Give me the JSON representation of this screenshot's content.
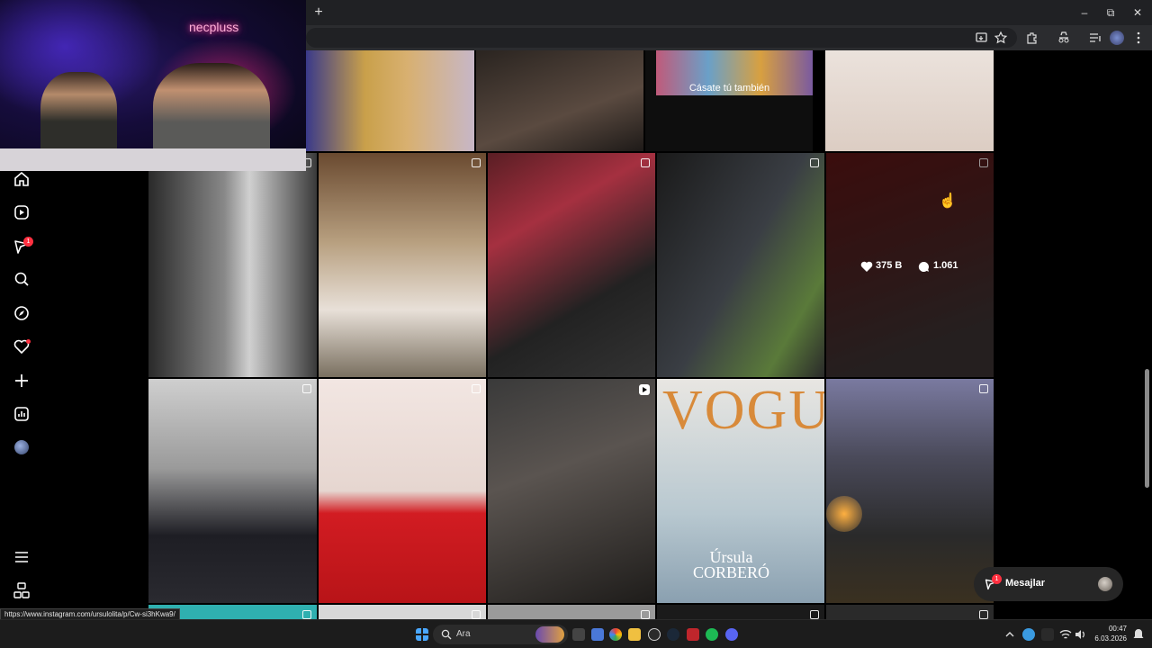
{
  "browser": {
    "new_tab_label": "+",
    "window_controls": {
      "minimize": "–",
      "restore": "⧉",
      "close": "✕"
    },
    "toolbar_icons": [
      "install-icon",
      "star-icon",
      "extensions-icon",
      "incognito-icon",
      "media-icon",
      "profile-avatar",
      "menu-icon"
    ]
  },
  "webcam": {
    "neon_sign": "necpluss"
  },
  "sidebar": {
    "items": [
      {
        "name": "home-icon"
      },
      {
        "name": "reels-icon"
      },
      {
        "name": "messages-icon",
        "badge": "1"
      },
      {
        "name": "search-icon"
      },
      {
        "name": "explore-icon"
      },
      {
        "name": "notifications-icon",
        "dot": true
      },
      {
        "name": "create-icon"
      },
      {
        "name": "dashboard-icon"
      },
      {
        "name": "profile-avatar"
      }
    ],
    "bottom": [
      {
        "name": "menu-icon"
      },
      {
        "name": "threads-icon"
      }
    ]
  },
  "grid": {
    "top_row_caption": "Cásate tú también",
    "hovered_post": {
      "likes": "375 B",
      "comments": "1.061"
    },
    "vogue_cover": {
      "masthead": "VOGUE",
      "name_line1": "Úrsula",
      "name_line2": "CORBERÓ"
    }
  },
  "messages_button": {
    "label": "Mesajlar",
    "badge": "1"
  },
  "status_url": "https://www.instagram.com/ursulolita/p/Cw-si3hKwa9/",
  "taskbar": {
    "search_label": "Ara",
    "time": "00:47",
    "date": "6.03.2026"
  },
  "colors": {
    "accent_badge": "#ff3040",
    "vogue_orange": "#d88a3a"
  }
}
